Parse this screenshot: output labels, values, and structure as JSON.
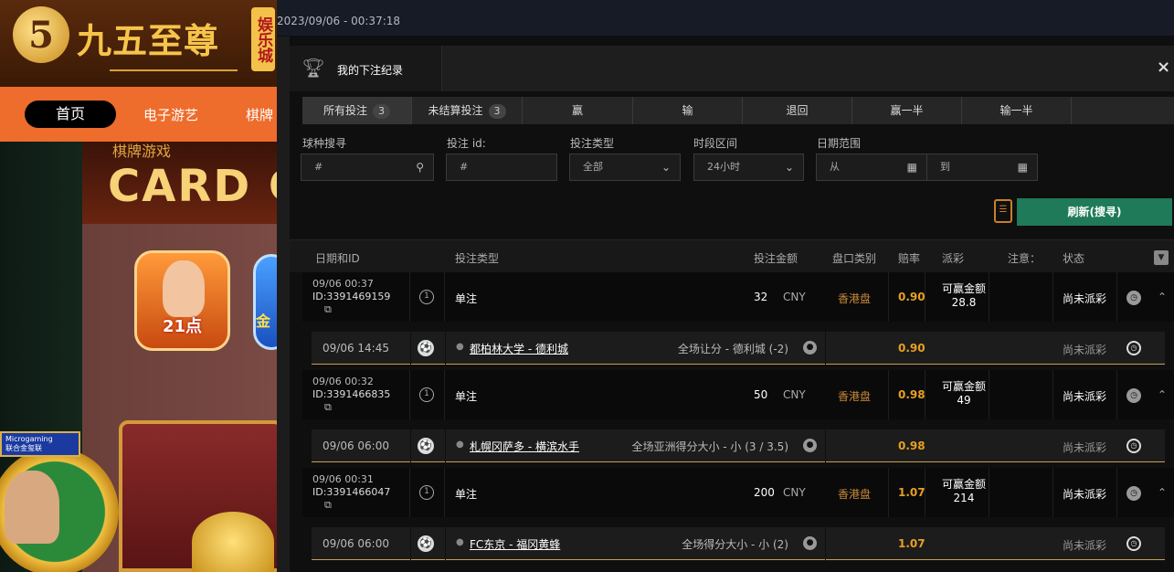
{
  "background_site": {
    "logo_digit": "5",
    "logo_text": "九五至尊",
    "logo_tag": "娱乐城",
    "nav": [
      "首页",
      "电子游艺",
      "棋牌"
    ],
    "section_subtitle": "棋牌游戏",
    "section_title": "CARD GA",
    "game1_label": "21点",
    "game2_label": "金",
    "provider_label": "Microgaming",
    "provider_sub": "联合金玺联"
  },
  "topbar": {
    "datetime": "2023/09/06 - 00:37:18"
  },
  "modal": {
    "title": "我的下注纪录",
    "close_icon": "×",
    "tabs": [
      {
        "label": "所有投注",
        "count": "3"
      },
      {
        "label": "未结算投注",
        "count": "3"
      },
      {
        "label": "赢"
      },
      {
        "label": "输"
      },
      {
        "label": "退回"
      },
      {
        "label": "赢一半"
      },
      {
        "label": "输一半"
      }
    ],
    "filters": {
      "sport_label": "球种搜寻",
      "sport_placeholder": "#",
      "betid_label": "投注 id:",
      "betid_placeholder": "#",
      "bettype_label": "投注类型",
      "bettype_value": "全部",
      "period_label": "时段区间",
      "period_value": "24小时",
      "date_label": "日期范围",
      "date_from": "从",
      "date_to": "到"
    },
    "refresh_label": "刷新(搜寻)",
    "columns": [
      "日期和ID",
      "投注类型",
      "投注金额",
      "盘口类别",
      "赔率",
      "派彩",
      "注意：",
      "状态"
    ],
    "bets": [
      {
        "date": "09/06 00:37",
        "id": "ID:3391469159",
        "num": "1",
        "type": "单注",
        "amount": "32",
        "currency": "CNY",
        "odds_type": "香港盘",
        "odds": "0.90",
        "win_label": "可赢金额",
        "win_amount": "28.8",
        "status": "尚未派彩",
        "sel": {
          "time": "09/06 14:45",
          "match": "都柏林大学 - 德利城",
          "market": "全场让分 - 德利城 (-2)",
          "odds": "0.90",
          "status": "尚未派彩"
        }
      },
      {
        "date": "09/06 00:32",
        "id": "ID:3391466835",
        "num": "1",
        "type": "单注",
        "amount": "50",
        "currency": "CNY",
        "odds_type": "香港盘",
        "odds": "0.98",
        "win_label": "可赢金额",
        "win_amount": "49",
        "status": "尚未派彩",
        "sel": {
          "time": "09/06 06:00",
          "match": "札幌冈萨多 - 横滨水手",
          "market": "全场亚洲得分大小 - 小 (3 / 3.5)",
          "odds": "0.98",
          "status": "尚未派彩"
        }
      },
      {
        "date": "09/06 00:31",
        "id": "ID:3391466047",
        "num": "1",
        "type": "单注",
        "amount": "200",
        "currency": "CNY",
        "odds_type": "香港盘",
        "odds": "1.07",
        "win_label": "可赢金额",
        "win_amount": "214",
        "status": "尚未派彩",
        "sel": {
          "time": "09/06 06:00",
          "match": "FC东京 - 福冈黄蜂",
          "market": "全场得分大小 - 小 (2)",
          "odds": "1.07",
          "status": "尚未派彩"
        }
      }
    ]
  }
}
